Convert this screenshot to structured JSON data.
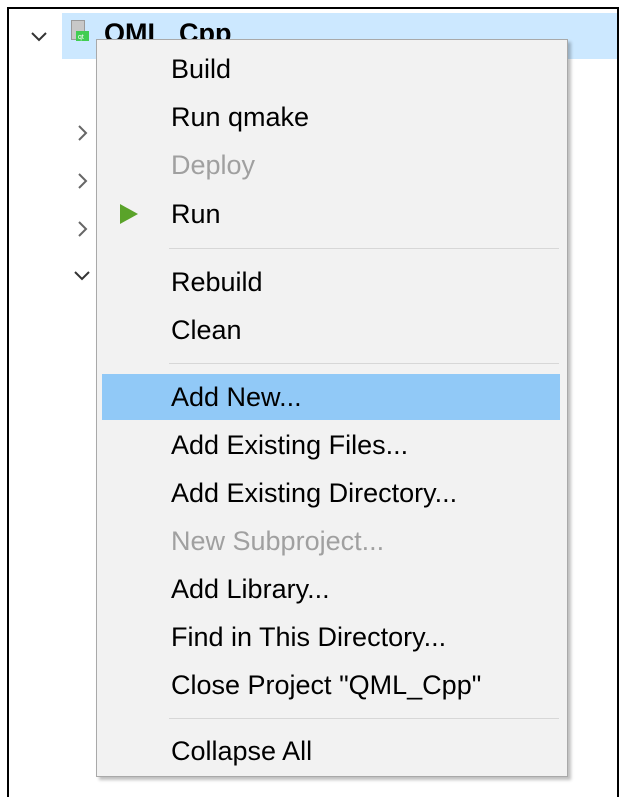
{
  "project": {
    "title": "QML_Cpp",
    "icon": "qt-project-file-icon"
  },
  "tree": {
    "chevrons": [
      "chevron-down-icon",
      "chevron-right-icon",
      "chevron-right-icon",
      "chevron-right-icon",
      "chevron-down-icon"
    ]
  },
  "context_menu": {
    "items": [
      {
        "label": "Build",
        "enabled": true
      },
      {
        "label": "Run qmake",
        "enabled": true
      },
      {
        "label": "Deploy",
        "enabled": false
      },
      {
        "label": "Run",
        "enabled": true,
        "icon": "play-icon",
        "icon_color": "#5aa32a"
      },
      {
        "label": "Rebuild",
        "enabled": true
      },
      {
        "label": "Clean",
        "enabled": true
      },
      {
        "label": "Add New...",
        "enabled": true,
        "highlighted": true
      },
      {
        "label": "Add Existing Files...",
        "enabled": true
      },
      {
        "label": "Add Existing Directory...",
        "enabled": true
      },
      {
        "label": "New Subproject...",
        "enabled": false
      },
      {
        "label": "Add Library...",
        "enabled": true
      },
      {
        "label": "Find in This Directory...",
        "enabled": true
      },
      {
        "label": "Close Project \"QML_Cpp\"",
        "enabled": true
      },
      {
        "label": "Collapse All",
        "enabled": true
      }
    ]
  },
  "colors": {
    "selection": "#cce8ff",
    "menu_highlight": "#91c9f7",
    "menu_background": "#f2f2f2",
    "disabled_text": "#a0a0a0"
  }
}
